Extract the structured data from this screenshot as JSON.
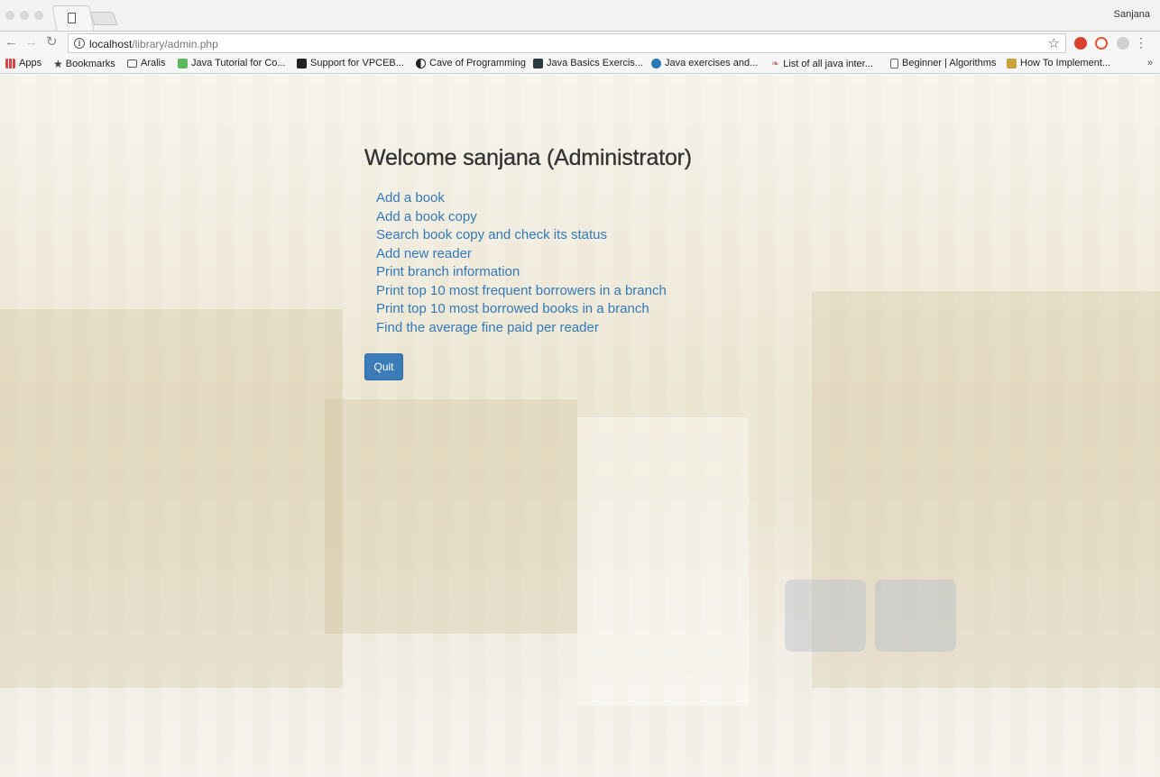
{
  "browser": {
    "profile_name": "Sanjana",
    "url_host": "localhost",
    "url_path": "/library/admin.php"
  },
  "bookmarks": [
    {
      "label": "Apps",
      "icon": "apps-grid-icon"
    },
    {
      "label": "Bookmarks",
      "icon": "star-icon"
    },
    {
      "label": "Aralis",
      "icon": "folder-icon"
    },
    {
      "label": "Java Tutorial for Co...",
      "icon": "udemy-icon"
    },
    {
      "label": "Support for VPCEB...",
      "icon": "sony-icon"
    },
    {
      "label": "Cave of Programming",
      "icon": "yin-yang-icon"
    },
    {
      "label": "Java Basics Exercis...",
      "icon": "hackerrank-icon"
    },
    {
      "label": "Java exercises and...",
      "icon": "globe-icon"
    },
    {
      "label": "List of all java inter...",
      "icon": "feather-icon"
    },
    {
      "label": "Beginner | Algorithms",
      "icon": "document-icon"
    },
    {
      "label": "How To Implement...",
      "icon": "code-icon"
    }
  ],
  "bookmarks_overflow": "»",
  "page": {
    "title": "Welcome sanjana (Administrator)",
    "links": [
      "Add a book",
      "Add a book copy",
      "Search book copy and check its status",
      "Add new reader",
      "Print branch information",
      "Print top 10 most frequent borrowers in a branch",
      "Print top 10 most borrowed books in a branch",
      "Find the average fine paid per reader"
    ],
    "quit_label": "Quit"
  }
}
